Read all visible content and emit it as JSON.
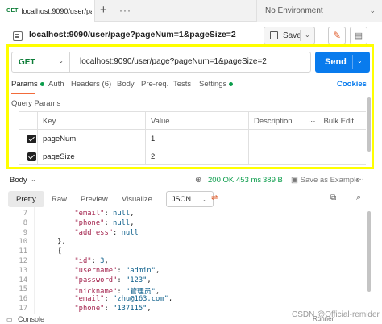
{
  "tab": {
    "method": "GET",
    "url": "localhost:9090/user/pa",
    "new_icon": "+",
    "more_icon": "···"
  },
  "environment": {
    "label": "No Environment"
  },
  "request": {
    "name": "localhost:9090/user/page?pageNum=1&pageSize=2",
    "save_label": "Save",
    "method": "GET",
    "url": "localhost:9090/user/page?pageNum=1&pageSize=2",
    "send_label": "Send"
  },
  "req_tabs": {
    "params": "Params",
    "auth": "Auth",
    "headers": "Headers (6)",
    "body": "Body",
    "prereq": "Pre-req.",
    "tests": "Tests",
    "settings": "Settings",
    "cookies": "Cookies"
  },
  "query_params": {
    "label": "Query Params",
    "headers": {
      "key": "Key",
      "value": "Value",
      "description": "Description",
      "bulk_edit": "Bulk Edit"
    },
    "rows": [
      {
        "key": "pageNum",
        "value": "1",
        "checked": true
      },
      {
        "key": "pageSize",
        "value": "2",
        "checked": true
      }
    ]
  },
  "response": {
    "body_label": "Body",
    "status": "200 OK",
    "time": "453 ms",
    "size": "389 B",
    "save_example": "Save as Example",
    "tabs": {
      "pretty": "Pretty",
      "raw": "Raw",
      "preview": "Preview",
      "visualize": "Visualize"
    },
    "format": "JSON"
  },
  "code_lines": [
    {
      "n": "7",
      "t": "        \"email\": null,"
    },
    {
      "n": "8",
      "t": "        \"phone\": null,"
    },
    {
      "n": "9",
      "t": "        \"address\": null"
    },
    {
      "n": "10",
      "t": "    },"
    },
    {
      "n": "11",
      "t": "    {"
    },
    {
      "n": "12",
      "t": "        \"id\": 3,"
    },
    {
      "n": "13",
      "t": "        \"username\": \"admin\","
    },
    {
      "n": "14",
      "t": "        \"password\": \"123\","
    },
    {
      "n": "15",
      "t": "        \"nickname\": \"管理员\","
    },
    {
      "n": "16",
      "t": "        \"email\": \"zhu@163.com\","
    },
    {
      "n": "17",
      "t": "        \"phone\": \"137115\","
    }
  ],
  "footer": {
    "console": "Console",
    "runner": "Runner"
  },
  "watermark": "CSDN @Official-remider",
  "colors": {
    "send": "#097bed",
    "get": "#0c7c37",
    "status_ok": "#0c9d4c",
    "highlight": "#ffff00",
    "active_tab": "#f26b3a"
  }
}
